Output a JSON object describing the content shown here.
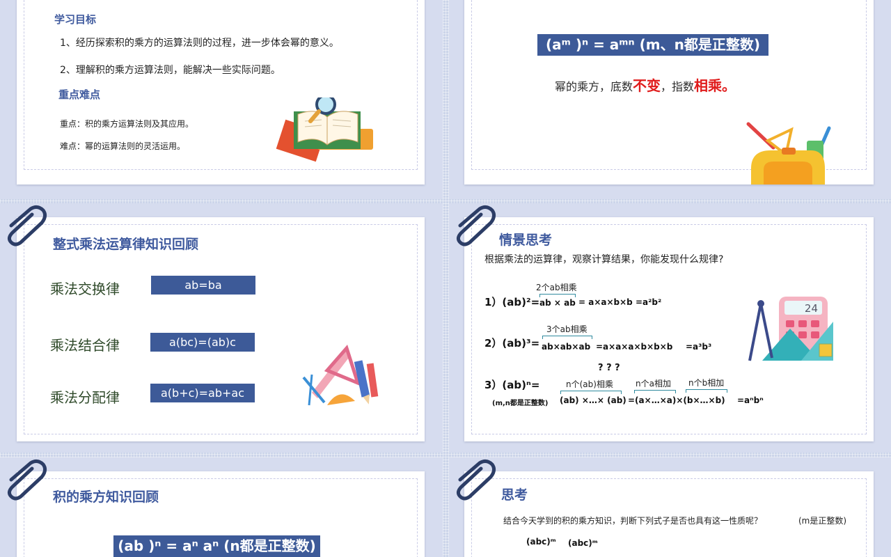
{
  "slide1": {
    "heading_goals": "学习目标",
    "goal1": "1、经历探索积的乘方的运算法则的过程，进一步体会幂的意义。",
    "goal2": "2、理解积的乘方运算法则，能解决一些实际问题。",
    "heading_key": "重点难点",
    "key_point": "重点：积的乘方运算法则及其应用。",
    "difficult_point": "难点：幂的运算法则的灵活运用。"
  },
  "slide2": {
    "formula": "(aᵐ )ⁿ =  aᵐⁿ     (m、n都是正整数)",
    "rule_prefix": "幂的乘方，底数",
    "rule_unchanged": "不变",
    "rule_mid": "，指数",
    "rule_multiply": "相乘。"
  },
  "slide3": {
    "title": "整式乘法运算律知识回顾",
    "law1_label": "乘法交换律",
    "law1_formula": "ab=ba",
    "law2_label": "乘法结合律",
    "law2_formula": "a(bc)=(ab)c",
    "law3_label": "乘法分配律",
    "law3_formula": "a(b+c)=ab+ac"
  },
  "slide4": {
    "title": "情景思考",
    "prompt": "根据乘法的运算律，观察计算结果，你能发现什么规律?",
    "calc_display": "24",
    "row1": {
      "label": "1）(ab)²=",
      "brace_label": "2个ab相乘",
      "expr": "ab × ab",
      "result": "= a×a×b×b   =a²b²"
    },
    "row2": {
      "label": "2）(ab)³=",
      "brace_label": "3个ab相乘",
      "expr": "ab×ab×ab",
      "result": "=a×a×a×b×b×b",
      "final": "=a³b³"
    },
    "row3": {
      "question": "? ? ?",
      "label": "3）(ab)ⁿ=",
      "condition": "(m,n都是正整数)",
      "brace1": "n个(ab)相乘",
      "expr1": "(ab) ×…× (ab)",
      "brace2": "n个a相加",
      "brace3": "n个b相加",
      "expr2": "=(a×…×a)×(b×…×b)",
      "final": "=aⁿbⁿ"
    }
  },
  "slide5": {
    "title": "积的乘方知识回顾",
    "formula": "(ab )ⁿ = aⁿ aⁿ     (n都是正整数)"
  },
  "slide6": {
    "title": "思考",
    "prompt": "结合今天学到的积的乘方知识，判断下列式子是否也具有这一性质呢？",
    "condition": "(m是正整数)",
    "expr1": "(abc)ᵐ",
    "expr2": "(abc)ᵐ"
  },
  "colors": {
    "accent_blue": "#3d5a98",
    "title_blue": "#3f5a9e",
    "highlight_red": "#e01c1c",
    "law_green": "#2f4a2a"
  },
  "icons": [
    "paperclip-icon",
    "book-magnifier-icon",
    "school-bag-icon",
    "ruler-pencil-icon",
    "calculator-icon"
  ]
}
